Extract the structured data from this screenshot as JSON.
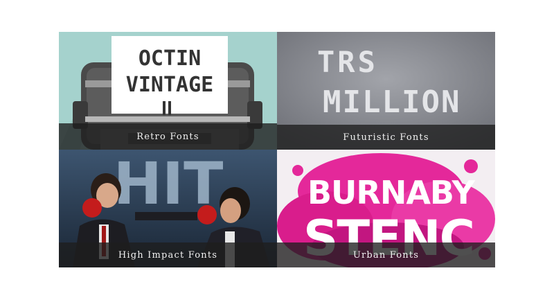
{
  "tiles": [
    {
      "caption": "Retro Fonts",
      "art_lines": [
        "OCTIN",
        "VINTAGE"
      ]
    },
    {
      "caption": "Futuristic Fonts",
      "art_lines": [
        "TRS",
        "MILLION"
      ]
    },
    {
      "caption": "High Impact Fonts",
      "art_lines": [
        "HIT"
      ]
    },
    {
      "caption": "Urban Fonts",
      "art_lines": [
        "BURNABY",
        "STENC"
      ]
    }
  ],
  "colors": {
    "retro_bg": "#9fcfca",
    "futuristic_bg": "#8d8f96",
    "impact_bg": "#2b3f55",
    "urban_splash": "#e4289a",
    "caption_overlay": "#1e1e1e"
  }
}
